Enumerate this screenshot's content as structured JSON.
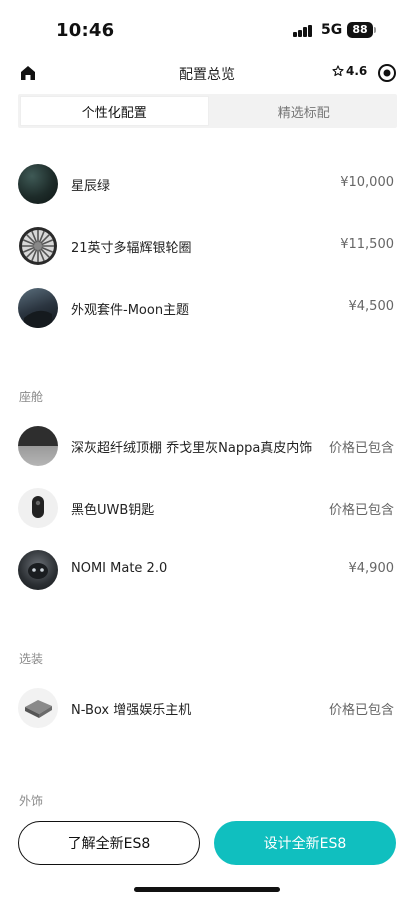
{
  "status_bar": {
    "time": "10:46",
    "network": "5G",
    "battery": "88"
  },
  "header": {
    "title": "配置总览",
    "rating": "4.6"
  },
  "tabs": [
    {
      "label": "个性化配置",
      "active": true
    },
    {
      "label": "精选标配",
      "active": false
    }
  ],
  "sections": {
    "cabin": "座舱",
    "options": "选装",
    "exterior_decor_partial": "外饰"
  },
  "items": [
    {
      "name": "星辰绿",
      "price": "¥10,000"
    },
    {
      "name": "21英寸多辐辉银轮圈",
      "price": "¥11,500"
    },
    {
      "name": "外观套件-Moon主题",
      "price": "¥4,500"
    },
    {
      "name": "深灰超纤绒顶棚 乔戈里灰Nappa真皮内饰",
      "price": "价格已包含"
    },
    {
      "name": "黑色UWB钥匙",
      "price": "价格已包含"
    },
    {
      "name": "NOMI Mate 2.0",
      "price": "¥4,900"
    },
    {
      "name": "N-Box 增强娱乐主机",
      "price": "价格已包含"
    }
  ],
  "bottom": {
    "learn_label": "了解全新ES8",
    "design_label": "设计全新ES8",
    "accent_color": "#10bfbf"
  }
}
